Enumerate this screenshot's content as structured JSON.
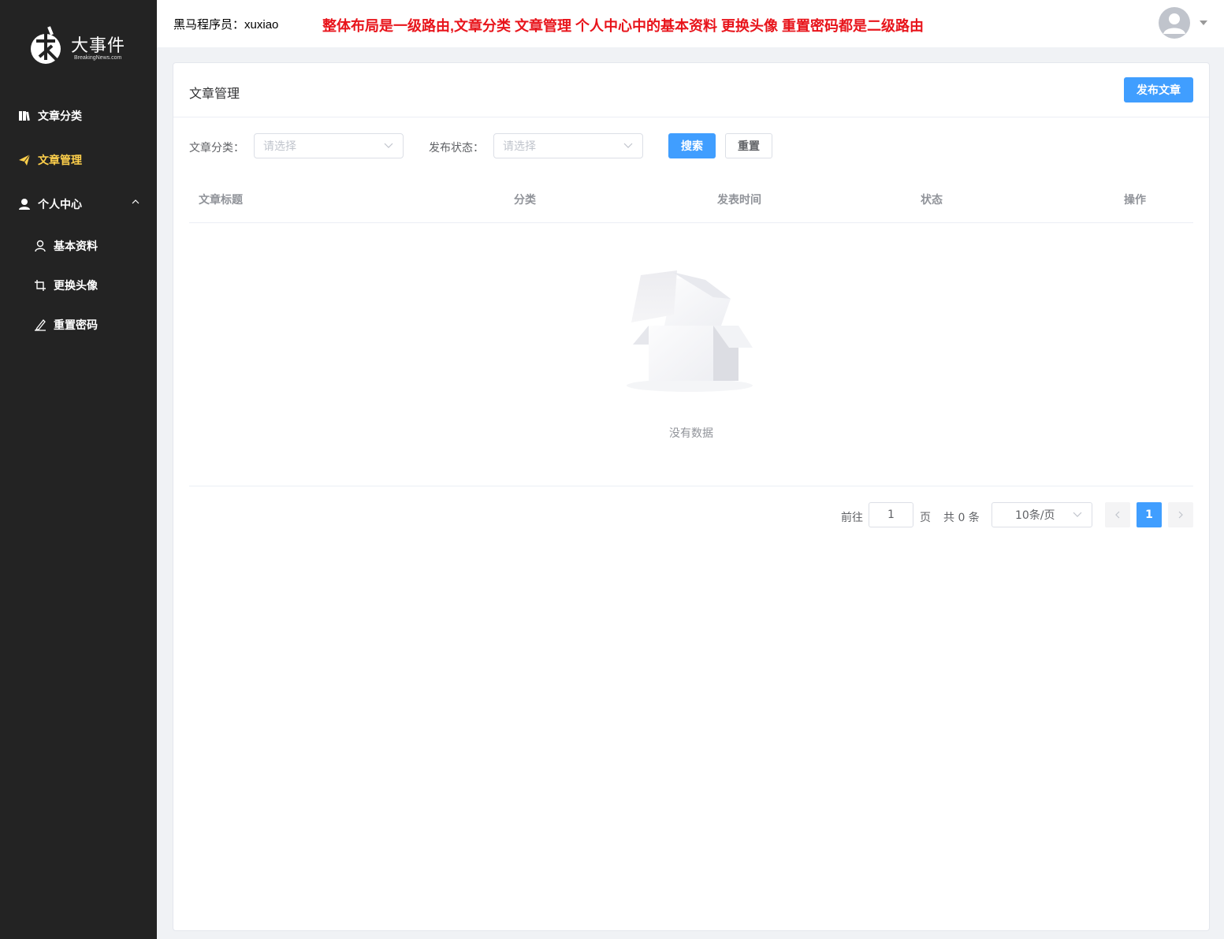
{
  "sidebar": {
    "logo": {
      "title": "大事件",
      "subtitle": "BreakingNews.com"
    },
    "items": [
      {
        "label": "文章分类",
        "icon": "book-icon"
      },
      {
        "label": "文章管理",
        "icon": "send-icon",
        "active": true
      },
      {
        "label": "个人中心",
        "icon": "user-icon",
        "expanded": true
      }
    ],
    "sub_items": [
      {
        "label": "基本资料",
        "icon": "user-outline-icon"
      },
      {
        "label": "更换头像",
        "icon": "crop-icon"
      },
      {
        "label": "重置密码",
        "icon": "edit-pen-icon"
      }
    ]
  },
  "header": {
    "user_prefix": "黑马程序员：",
    "username": "xuxiao",
    "note": "整体布局是一级路由,文章分类 文章管理 个人中心中的基本资料 更换头像 重置密码都是二级路由"
  },
  "card": {
    "title": "文章管理",
    "publish_label": "发布文章"
  },
  "filters": {
    "category_label": "文章分类：",
    "category_placeholder": "请选择",
    "status_label": "发布状态：",
    "status_placeholder": "请选择",
    "search_label": "搜索",
    "reset_label": "重置"
  },
  "table": {
    "columns": [
      "文章标题",
      "分类",
      "发表时间",
      "状态",
      "操作"
    ],
    "rows": [],
    "empty_text": "没有数据"
  },
  "pagination": {
    "goto_label": "前往",
    "goto_value": "1",
    "page_suffix": "页",
    "total_text": "共 0 条",
    "page_size": "10条/页",
    "current_page": "1"
  },
  "colors": {
    "primary": "#409eff",
    "sidebar_bg": "#232323",
    "active_menu": "#ffd04b",
    "note": "#e8141b"
  }
}
